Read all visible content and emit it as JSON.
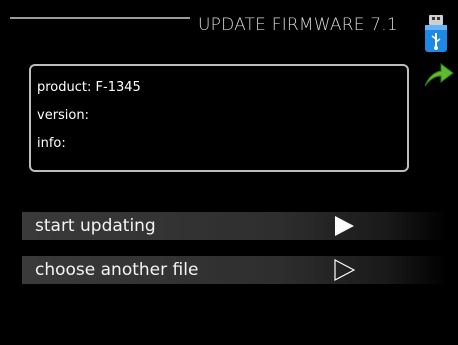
{
  "header": {
    "title": "UPDATE FIRMWARE 7.1"
  },
  "info": {
    "product_label": "product:",
    "product_value": "F-1345",
    "version_label": "version:",
    "info_label": "info:"
  },
  "menu": {
    "items": [
      {
        "label": "start updating",
        "icon": "play-filled-icon"
      },
      {
        "label": "choose another file",
        "icon": "play-outline-icon"
      }
    ]
  },
  "icons": {
    "usb": "usb-drive-icon",
    "back": "back-arrow-icon"
  },
  "colors": {
    "background": "#000000",
    "text": "#ffffff",
    "accent_green": "#4caf2f",
    "usb_blue": "#1e88e5"
  }
}
